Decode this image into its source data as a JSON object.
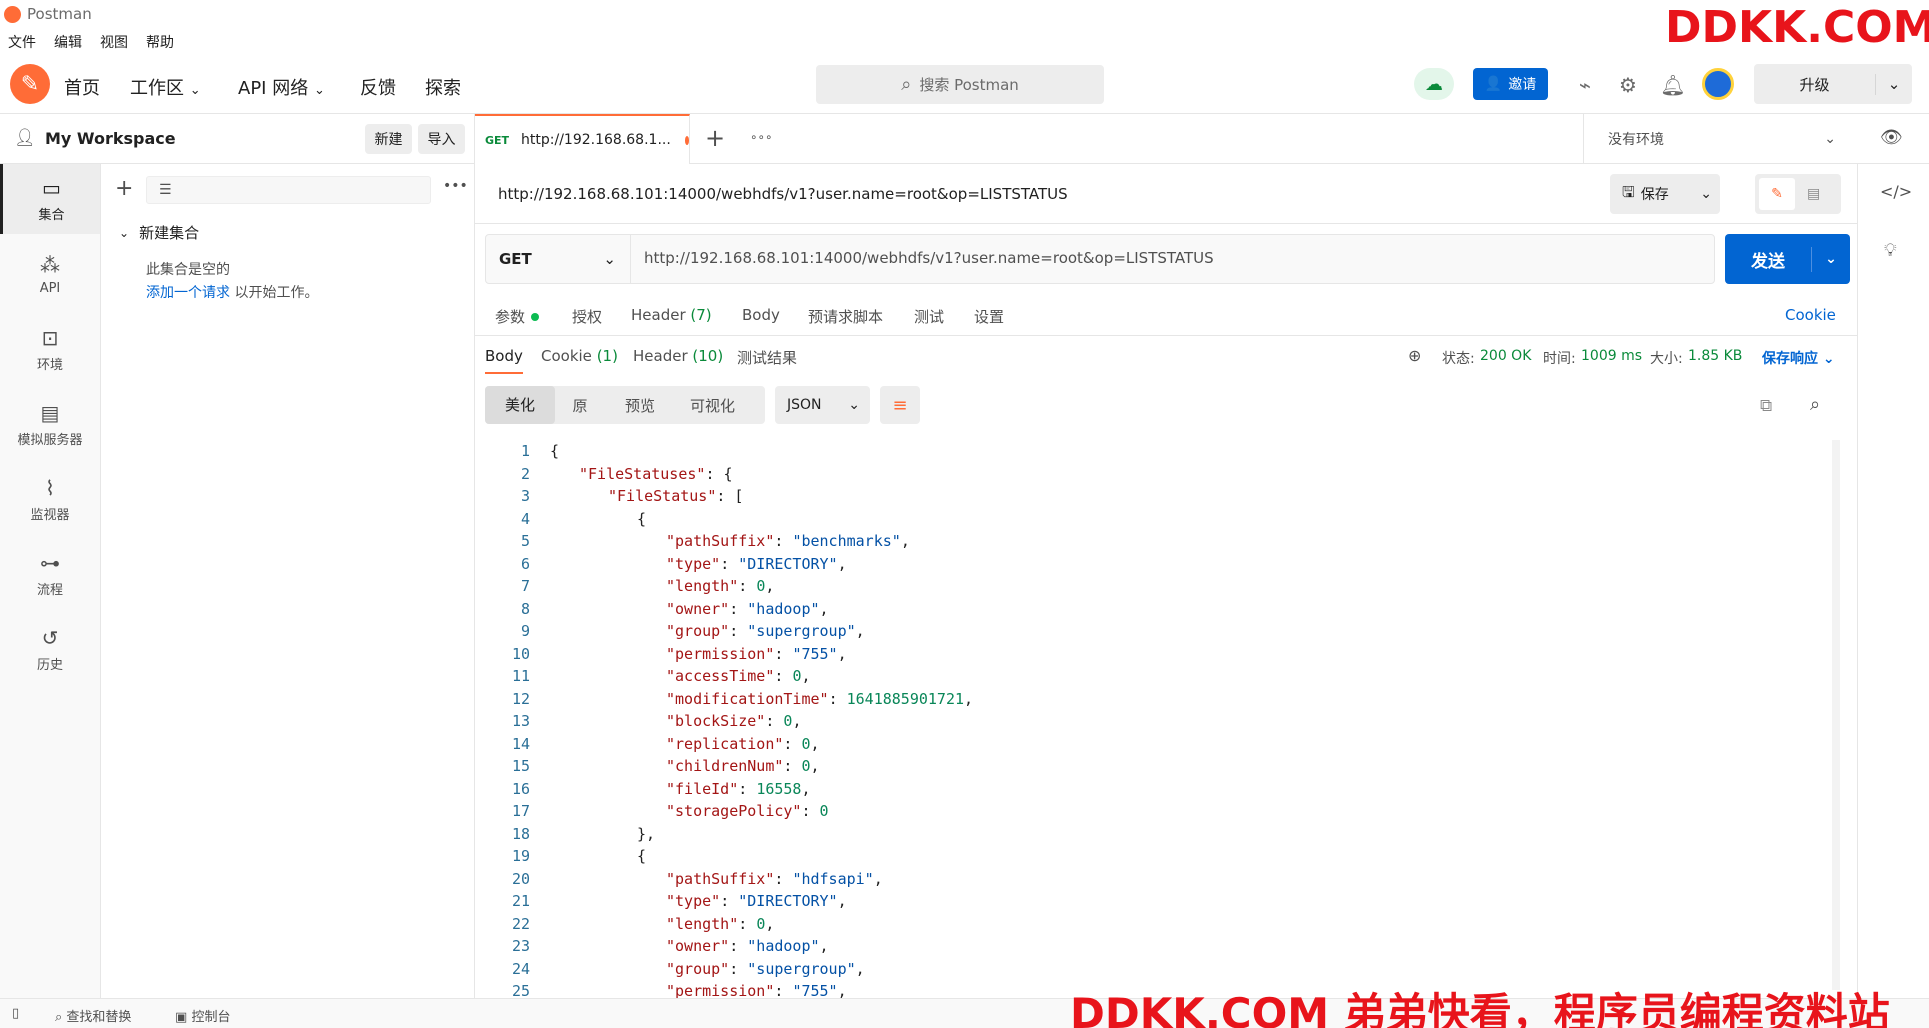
{
  "app": {
    "title": "Postman"
  },
  "menu": [
    "文件",
    "编辑",
    "视图",
    "帮助"
  ],
  "nav": {
    "home": "首页",
    "workspace": "工作区",
    "api_network": "API 网络",
    "feedback": "反馈",
    "explore": "探索"
  },
  "search": {
    "placeholder": "搜索 Postman"
  },
  "header": {
    "invite": "邀请",
    "upgrade": "升级"
  },
  "workspace": {
    "name": "My Workspace",
    "new": "新建",
    "import": "导入"
  },
  "rail": [
    {
      "label": "集合",
      "icon": "collection-icon"
    },
    {
      "label": "API",
      "icon": "api-icon"
    },
    {
      "label": "环境",
      "icon": "environment-icon"
    },
    {
      "label": "模拟服务器",
      "icon": "mock-server-icon"
    },
    {
      "label": "监视器",
      "icon": "monitor-icon"
    },
    {
      "label": "流程",
      "icon": "flow-icon"
    },
    {
      "label": "历史",
      "icon": "history-icon"
    }
  ],
  "collection": {
    "name": "新建集合",
    "empty_text": "此集合是空的",
    "add_link": "添加一个请求",
    "add_suffix": "以开始工作。"
  },
  "tab": {
    "method": "GET",
    "title": "http://192.168.68.1..."
  },
  "env": {
    "label": "没有环境"
  },
  "request": {
    "url": "http://192.168.68.101:14000/webhdfs/v1?user.name=root&op=LISTSTATUS",
    "method": "GET",
    "save": "保存",
    "send": "发送"
  },
  "req_tabs": {
    "params": "参数",
    "auth": "授权",
    "header": "Header",
    "header_count": "(7)",
    "body": "Body",
    "prescript": "预请求脚本",
    "tests": "测试",
    "settings": "设置",
    "cookie": "Cookie"
  },
  "resp_tabs": {
    "body": "Body",
    "cookie": "Cookie",
    "cookie_count": "(1)",
    "header": "Header",
    "header_count": "(10)",
    "results": "测试结果"
  },
  "resp_meta": {
    "status_label": "状态:",
    "status": "200 OK",
    "time_label": "时间:",
    "time": "1009 ms",
    "size_label": "大小:",
    "size": "1.85 KB",
    "save": "保存响应"
  },
  "formats": {
    "pretty": "美化",
    "raw": "原",
    "preview": "预览",
    "visualize": "可视化",
    "type": "JSON"
  },
  "code_lines": [
    {
      "n": "1",
      "ind": 0,
      "t": [
        [
          "p",
          "{"
        ]
      ]
    },
    {
      "n": "2",
      "ind": 1,
      "t": [
        [
          "k",
          "\"FileStatuses\""
        ],
        [
          "p",
          ": {"
        ]
      ]
    },
    {
      "n": "3",
      "ind": 2,
      "t": [
        [
          "k",
          "\"FileStatus\""
        ],
        [
          "p",
          ": ["
        ]
      ]
    },
    {
      "n": "4",
      "ind": 3,
      "t": [
        [
          "p",
          "{"
        ]
      ]
    },
    {
      "n": "5",
      "ind": 4,
      "t": [
        [
          "k",
          "\"pathSuffix\""
        ],
        [
          "p",
          ": "
        ],
        [
          "s",
          "\"benchmarks\""
        ],
        [
          "p",
          ","
        ]
      ]
    },
    {
      "n": "6",
      "ind": 4,
      "t": [
        [
          "k",
          "\"type\""
        ],
        [
          "p",
          ": "
        ],
        [
          "s",
          "\"DIRECTORY\""
        ],
        [
          "p",
          ","
        ]
      ]
    },
    {
      "n": "7",
      "ind": 4,
      "t": [
        [
          "k",
          "\"length\""
        ],
        [
          "p",
          ": "
        ],
        [
          "n",
          "0"
        ],
        [
          "p",
          ","
        ]
      ]
    },
    {
      "n": "8",
      "ind": 4,
      "t": [
        [
          "k",
          "\"owner\""
        ],
        [
          "p",
          ": "
        ],
        [
          "s",
          "\"hadoop\""
        ],
        [
          "p",
          ","
        ]
      ]
    },
    {
      "n": "9",
      "ind": 4,
      "t": [
        [
          "k",
          "\"group\""
        ],
        [
          "p",
          ": "
        ],
        [
          "s",
          "\"supergroup\""
        ],
        [
          "p",
          ","
        ]
      ]
    },
    {
      "n": "10",
      "ind": 4,
      "t": [
        [
          "k",
          "\"permission\""
        ],
        [
          "p",
          ": "
        ],
        [
          "s",
          "\"755\""
        ],
        [
          "p",
          ","
        ]
      ]
    },
    {
      "n": "11",
      "ind": 4,
      "t": [
        [
          "k",
          "\"accessTime\""
        ],
        [
          "p",
          ": "
        ],
        [
          "n",
          "0"
        ],
        [
          "p",
          ","
        ]
      ]
    },
    {
      "n": "12",
      "ind": 4,
      "t": [
        [
          "k",
          "\"modificationTime\""
        ],
        [
          "p",
          ": "
        ],
        [
          "n",
          "1641885901721"
        ],
        [
          "p",
          ","
        ]
      ]
    },
    {
      "n": "13",
      "ind": 4,
      "t": [
        [
          "k",
          "\"blockSize\""
        ],
        [
          "p",
          ": "
        ],
        [
          "n",
          "0"
        ],
        [
          "p",
          ","
        ]
      ]
    },
    {
      "n": "14",
      "ind": 4,
      "t": [
        [
          "k",
          "\"replication\""
        ],
        [
          "p",
          ": "
        ],
        [
          "n",
          "0"
        ],
        [
          "p",
          ","
        ]
      ]
    },
    {
      "n": "15",
      "ind": 4,
      "t": [
        [
          "k",
          "\"childrenNum\""
        ],
        [
          "p",
          ": "
        ],
        [
          "n",
          "0"
        ],
        [
          "p",
          ","
        ]
      ]
    },
    {
      "n": "16",
      "ind": 4,
      "t": [
        [
          "k",
          "\"fileId\""
        ],
        [
          "p",
          ": "
        ],
        [
          "n",
          "16558"
        ],
        [
          "p",
          ","
        ]
      ]
    },
    {
      "n": "17",
      "ind": 4,
      "t": [
        [
          "k",
          "\"storagePolicy\""
        ],
        [
          "p",
          ": "
        ],
        [
          "n",
          "0"
        ]
      ]
    },
    {
      "n": "18",
      "ind": 3,
      "t": [
        [
          "p",
          "},"
        ]
      ]
    },
    {
      "n": "19",
      "ind": 3,
      "t": [
        [
          "p",
          "{"
        ]
      ]
    },
    {
      "n": "20",
      "ind": 4,
      "t": [
        [
          "k",
          "\"pathSuffix\""
        ],
        [
          "p",
          ": "
        ],
        [
          "s",
          "\"hdfsapi\""
        ],
        [
          "p",
          ","
        ]
      ]
    },
    {
      "n": "21",
      "ind": 4,
      "t": [
        [
          "k",
          "\"type\""
        ],
        [
          "p",
          ": "
        ],
        [
          "s",
          "\"DIRECTORY\""
        ],
        [
          "p",
          ","
        ]
      ]
    },
    {
      "n": "22",
      "ind": 4,
      "t": [
        [
          "k",
          "\"length\""
        ],
        [
          "p",
          ": "
        ],
        [
          "n",
          "0"
        ],
        [
          "p",
          ","
        ]
      ]
    },
    {
      "n": "23",
      "ind": 4,
      "t": [
        [
          "k",
          "\"owner\""
        ],
        [
          "p",
          ": "
        ],
        [
          "s",
          "\"hadoop\""
        ],
        [
          "p",
          ","
        ]
      ]
    },
    {
      "n": "24",
      "ind": 4,
      "t": [
        [
          "k",
          "\"group\""
        ],
        [
          "p",
          ": "
        ],
        [
          "s",
          "\"supergroup\""
        ],
        [
          "p",
          ","
        ]
      ]
    },
    {
      "n": "25",
      "ind": 4,
      "t": [
        [
          "k",
          "\"permission\""
        ],
        [
          "p",
          ": "
        ],
        [
          "s",
          "\"755\""
        ],
        [
          "p",
          ","
        ]
      ]
    }
  ],
  "statusbar": {
    "find": "查找和替换",
    "console": "控制台"
  },
  "watermark": {
    "top": "DDKK.COM",
    "bottom": "DDKK.COM 弟弟快看，程序员编程资料站"
  },
  "colors": {
    "brand": "#ff6c37",
    "send": "#0265d2",
    "status_ok": "#0a8a3a",
    "watermark": "#e8141b"
  }
}
